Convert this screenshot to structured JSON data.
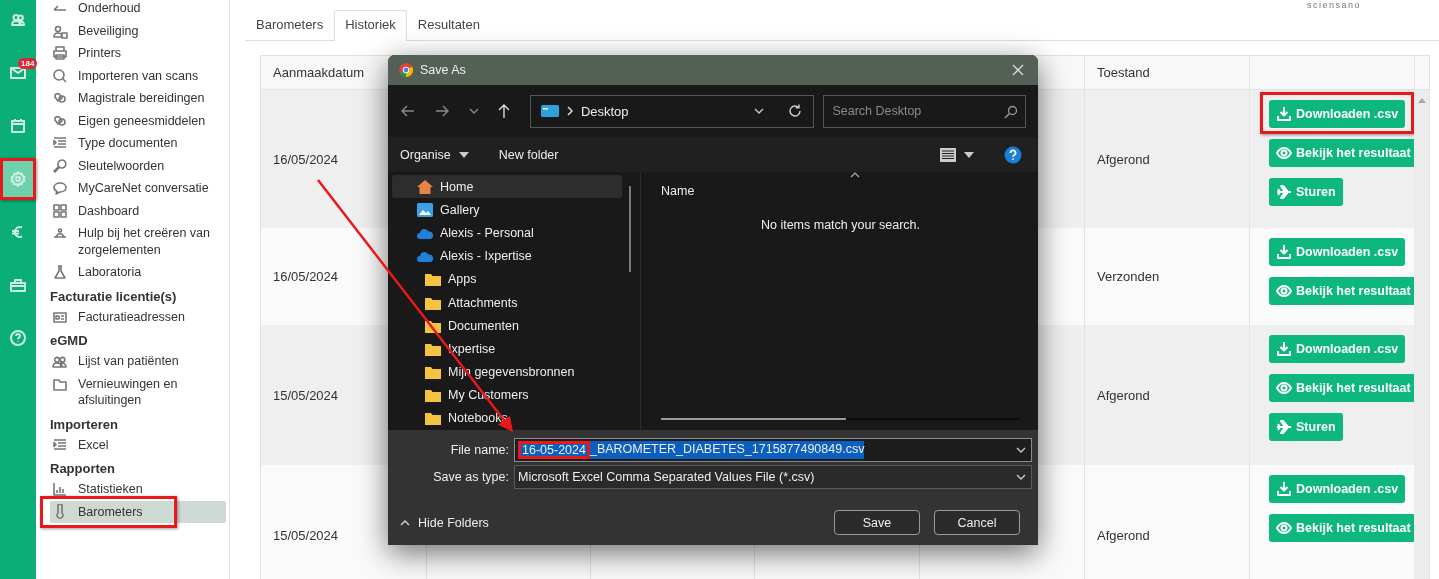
{
  "rail": [
    {
      "kind": "users",
      "selected": false,
      "highlighted": false
    },
    {
      "kind": "mail",
      "selected": false,
      "highlighted": false,
      "badge": "184"
    },
    {
      "kind": "calendar",
      "selected": false,
      "highlighted": false
    },
    {
      "kind": "settings",
      "selected": true,
      "highlighted": true
    },
    {
      "kind": "euro",
      "selected": false,
      "highlighted": false
    },
    {
      "kind": "toolbox",
      "selected": false,
      "highlighted": false
    },
    {
      "kind": "help",
      "selected": false,
      "highlighted": false
    }
  ],
  "sidebar": [
    {
      "kind": "item",
      "label": "Onderhoud",
      "selected": false,
      "highlighted": false
    },
    {
      "kind": "item",
      "label": "Beveiliging",
      "selected": false,
      "highlighted": false
    },
    {
      "kind": "item",
      "label": "Printers",
      "selected": false,
      "highlighted": false
    },
    {
      "kind": "item",
      "label": "Importeren van scans",
      "selected": false,
      "highlighted": false
    },
    {
      "kind": "item",
      "label": "Magistrale bereidingen",
      "selected": false,
      "highlighted": false
    },
    {
      "kind": "item",
      "label": "Eigen geneesmiddelen",
      "selected": false,
      "highlighted": false
    },
    {
      "kind": "item",
      "label": "Type documenten",
      "selected": false,
      "highlighted": false
    },
    {
      "kind": "item",
      "label": "Sleutelwoorden",
      "selected": false,
      "highlighted": false
    },
    {
      "kind": "item",
      "label": "MyCareNet conversatie",
      "selected": false,
      "highlighted": false
    },
    {
      "kind": "item",
      "label": "Dashboard",
      "selected": false,
      "highlighted": false
    },
    {
      "kind": "item",
      "label": "Hulp bij het creëren van zorgelementen",
      "selected": false,
      "highlighted": false
    },
    {
      "kind": "item",
      "label": "Laboratoria",
      "selected": false,
      "highlighted": false
    },
    {
      "kind": "heading",
      "label": "Facturatie licentie(s)"
    },
    {
      "kind": "item",
      "label": "Facturatieadressen",
      "selected": false,
      "highlighted": false
    },
    {
      "kind": "heading",
      "label": "eGMD"
    },
    {
      "kind": "item",
      "label": "Lijst van patiënten",
      "selected": false,
      "highlighted": false
    },
    {
      "kind": "item",
      "label": "Vernieuwingen en afsluitingen",
      "selected": false,
      "highlighted": false
    },
    {
      "kind": "heading",
      "label": "Importeren"
    },
    {
      "kind": "item",
      "label": "Excel",
      "selected": false,
      "highlighted": false
    },
    {
      "kind": "heading",
      "label": "Rapporten"
    },
    {
      "kind": "item",
      "label": "Statistieken",
      "selected": false,
      "highlighted": false
    },
    {
      "kind": "item",
      "label": "Barometers",
      "selected": true,
      "highlighted": true
    }
  ],
  "logo": "sciensano",
  "tabs": [
    {
      "label": "Barometers",
      "selected": false
    },
    {
      "label": "Historiek",
      "selected": true
    },
    {
      "label": "Resultaten",
      "selected": false
    }
  ],
  "table": {
    "columns": [
      "Aanmaakdatum",
      "Toestand"
    ],
    "rows": [
      {
        "date": "16/05/2024",
        "status": "Afgerond",
        "actions": [
          {
            "kind": "download",
            "label": "Downloaden .csv",
            "highlighted": true
          },
          {
            "kind": "view",
            "label": "Bekijk het resultaat",
            "highlighted": false
          },
          {
            "kind": "send",
            "label": "Sturen",
            "highlighted": false
          }
        ]
      },
      {
        "date": "16/05/2024",
        "status": "Verzonden",
        "actions": [
          {
            "kind": "download",
            "label": "Downloaden .csv",
            "highlighted": false
          },
          {
            "kind": "view",
            "label": "Bekijk het resultaat",
            "highlighted": false
          }
        ]
      },
      {
        "date": "15/05/2024",
        "status": "Afgerond",
        "actions": [
          {
            "kind": "download",
            "label": "Downloaden .csv",
            "highlighted": false
          },
          {
            "kind": "view",
            "label": "Bekijk het resultaat",
            "highlighted": false
          },
          {
            "kind": "send",
            "label": "Sturen",
            "highlighted": false
          }
        ]
      },
      {
        "date": "15/05/2024",
        "status": "Afgerond",
        "actions": [
          {
            "kind": "download",
            "label": "Downloaden .csv",
            "highlighted": false
          },
          {
            "kind": "view",
            "label": "Bekijk het resultaat",
            "highlighted": false
          }
        ]
      }
    ]
  },
  "dialog": {
    "title": "Save As",
    "location": "Desktop",
    "search": {
      "placeholder": "Search Desktop"
    },
    "commands": [
      "Organise",
      "New folder"
    ],
    "nav": [
      {
        "kind": "home",
        "label": "Home",
        "selected": true
      },
      {
        "kind": "gallery",
        "label": "Gallery",
        "selected": false
      },
      {
        "kind": "cloud",
        "label": "Alexis - Personal",
        "selected": false
      },
      {
        "kind": "cloud",
        "label": "Alexis - Ixpertise",
        "selected": false
      },
      {
        "kind": "folder",
        "label": "Apps",
        "selected": false
      },
      {
        "kind": "folder",
        "label": "Attachments",
        "selected": false
      },
      {
        "kind": "folder",
        "label": "Documenten",
        "selected": false
      },
      {
        "kind": "folder",
        "label": "Ixpertise",
        "selected": false
      },
      {
        "kind": "folder",
        "label": "Mijn gegevensbronnen",
        "selected": false
      },
      {
        "kind": "folder",
        "label": "My Customers",
        "selected": false
      },
      {
        "kind": "folder",
        "label": "Notebooks",
        "selected": false
      }
    ],
    "column": "Name",
    "empty_message": "No items match your search.",
    "file_name_label": "File name:",
    "file_name": [
      {
        "text": "16-05-2024",
        "highlighted": true
      },
      {
        "text": "_BAROMETER_DIABETES_1715877490849.csv",
        "highlighted": false
      }
    ],
    "type_label": "Save as type:",
    "type_value": "Microsoft Excel Comma Separated Values File (*.csv)",
    "hide_folders": "Hide Folders",
    "buttons": [
      "Save",
      "Cancel"
    ]
  }
}
